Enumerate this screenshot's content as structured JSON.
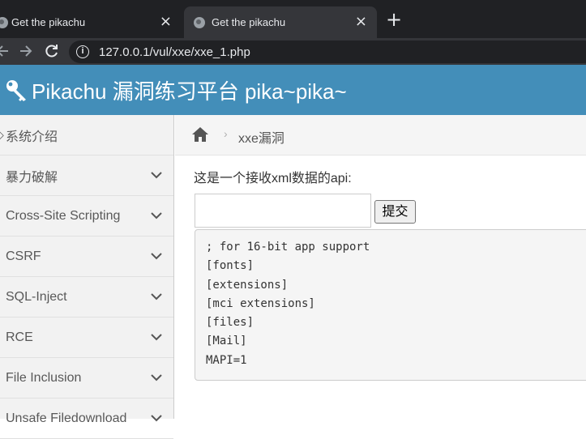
{
  "browser": {
    "tabs": [
      {
        "title": "Get the pikachu"
      },
      {
        "title": "Get the pikachu"
      }
    ],
    "url": "127.0.0.1/vul/xxe/xxe_1.php"
  },
  "header": {
    "title": "Pikachu 漏洞练习平台 pika~pika~"
  },
  "sidebar": {
    "items": [
      {
        "label": "系统介绍"
      },
      {
        "label": "暴力破解"
      },
      {
        "label": "Cross-Site Scripting"
      },
      {
        "label": "CSRF"
      },
      {
        "label": "SQL-Inject"
      },
      {
        "label": "RCE"
      },
      {
        "label": "File Inclusion"
      },
      {
        "label": "Unsafe Filedownload"
      }
    ]
  },
  "breadcrumb": {
    "current": "xxe漏洞"
  },
  "main": {
    "description": "这是一个接收xml数据的api:",
    "input_value": "",
    "submit_label": "提交",
    "result_lines": [
      "; for 16-bit app support",
      "[fonts]",
      "[extensions]",
      "[mci extensions]",
      "[files]",
      "[Mail]",
      "MAPI=1"
    ]
  },
  "colors": {
    "header_bg": "#438eb9",
    "sidebar_bg": "#f2f2f2",
    "chrome_dark": "#202124",
    "chrome_tab": "#35363a"
  }
}
